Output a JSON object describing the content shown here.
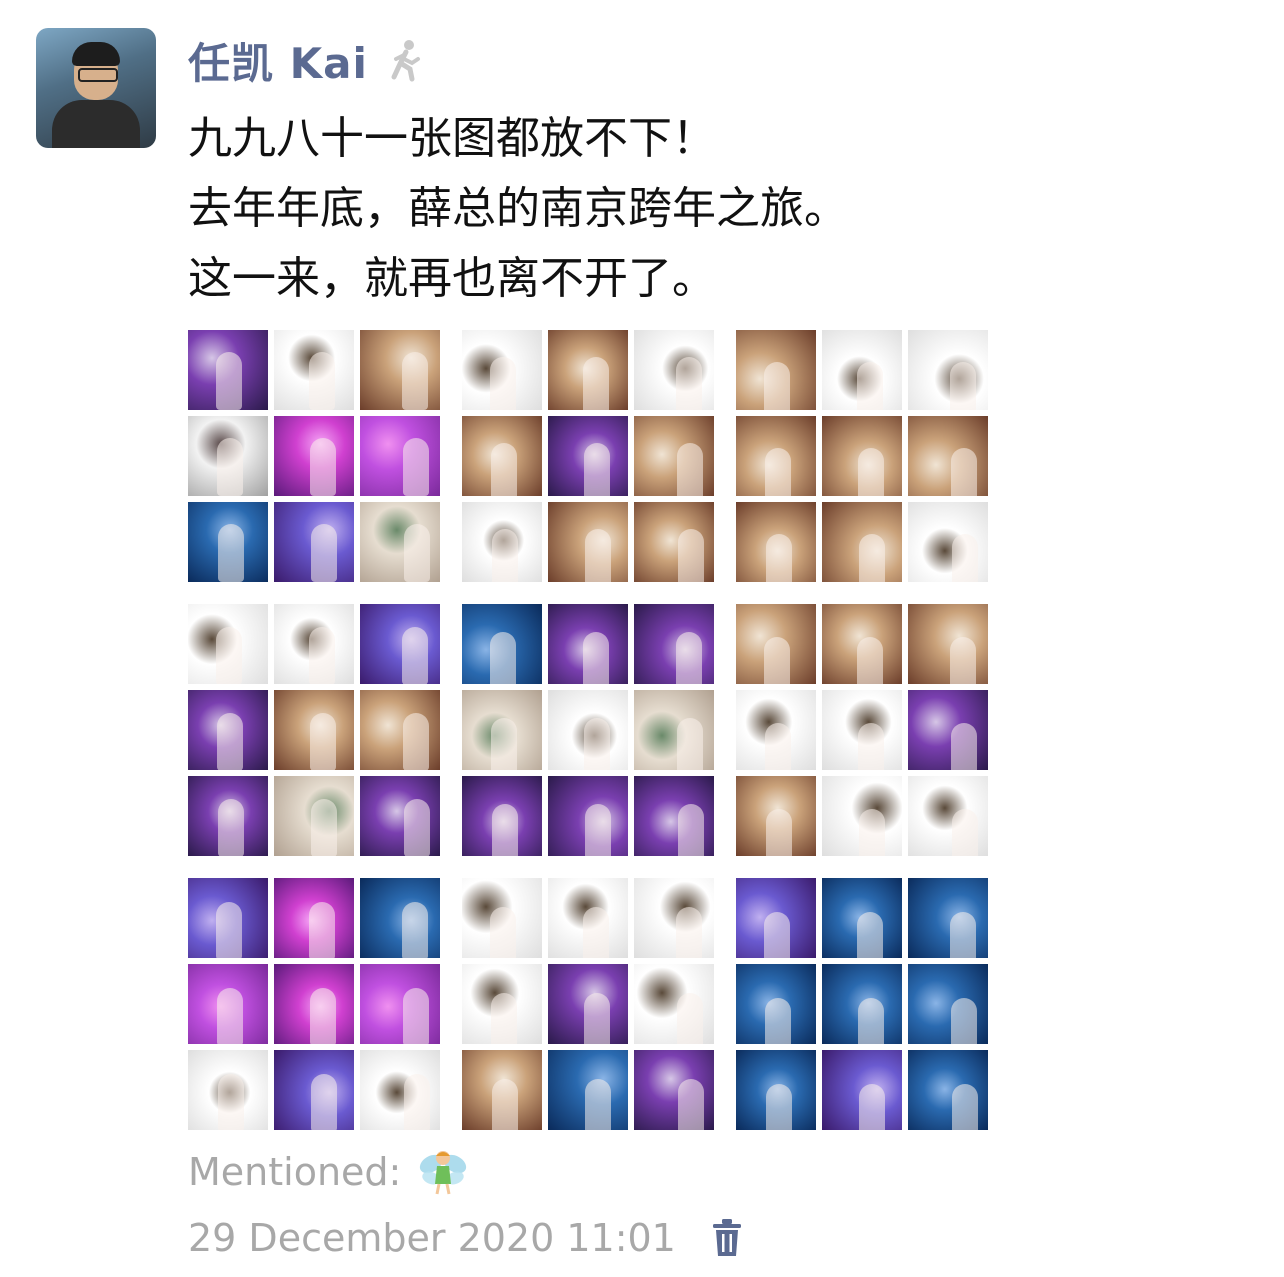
{
  "post": {
    "author": "任凯 Kai",
    "status_icon": "walking-person-icon",
    "lines": [
      "九九八十一张图都放不下！",
      "去年年底，薛总的南京跨年之旅。",
      "这一来，就再也离不开了。"
    ],
    "mentioned_label": "Mentioned:",
    "mentioned_icon": "fairy-emoji",
    "timestamp": "29 December 2020 11:01",
    "delete_icon": "trash-icon"
  },
  "colors": {
    "name_blue": "#5b6a91",
    "meta_gray": "#a8a8a8",
    "trash_blue": "#5b6a91"
  }
}
